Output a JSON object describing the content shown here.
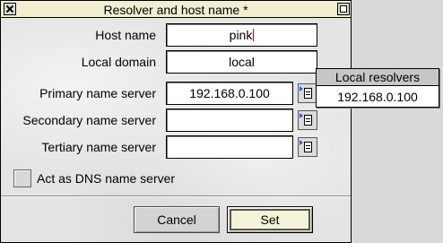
{
  "window": {
    "title": "Resolver and host name *"
  },
  "fields": {
    "host_name": {
      "label": "Host name",
      "value": "pink"
    },
    "local_domain": {
      "label": "Local domain",
      "value": "local"
    },
    "primary_ns": {
      "label": "Primary name server",
      "value": "192.168.0.100"
    },
    "secondary_ns": {
      "label": "Secondary name server",
      "value": ""
    },
    "tertiary_ns": {
      "label": "Tertiary name server",
      "value": ""
    }
  },
  "options": {
    "act_as_dns": {
      "label": "Act as DNS name server",
      "checked": false
    }
  },
  "buttons": {
    "cancel": "Cancel",
    "set": "Set"
  },
  "popup_menu": {
    "title": "Local resolvers",
    "items": [
      "192.168.0.100"
    ]
  },
  "icons": {
    "close": "close-icon",
    "maximize": "maximize-icon",
    "menu": "popup-menu-icon"
  }
}
